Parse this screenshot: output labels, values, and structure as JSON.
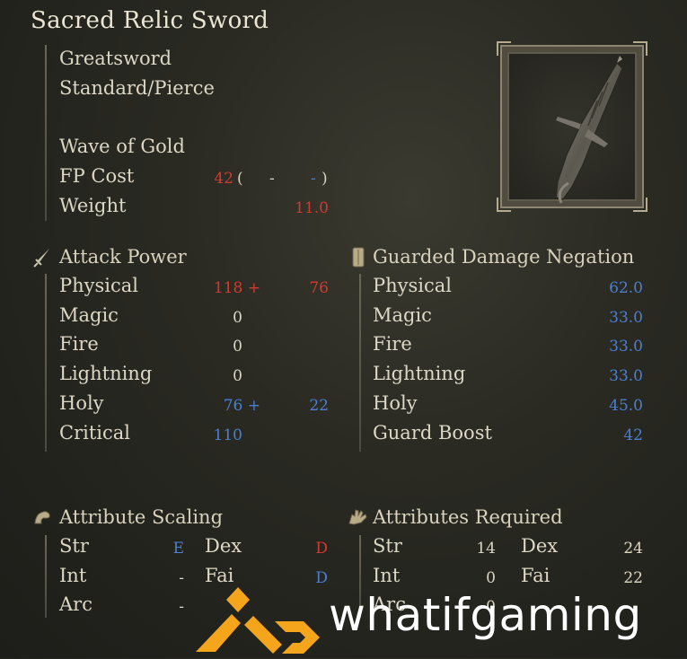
{
  "item": {
    "name": "Sacred Relic Sword",
    "type": "Greatsword",
    "attack_type": "Standard/Pierce",
    "skill": "Wave of Gold",
    "fp_label": "FP Cost",
    "fp_value": "42",
    "fp_paren_open": "(",
    "fp_dash1": "-",
    "fp_dash2": "-",
    "fp_paren_close": ")",
    "weight_label": "Weight",
    "weight_value": "11.0"
  },
  "attack_power": {
    "header": "Attack Power",
    "rows": [
      {
        "label": "Physical",
        "base": "118 +",
        "bonus": "76"
      },
      {
        "label": "Magic",
        "base": "0",
        "bonus": ""
      },
      {
        "label": "Fire",
        "base": "0",
        "bonus": ""
      },
      {
        "label": "Lightning",
        "base": "0",
        "bonus": ""
      },
      {
        "label": "Holy",
        "base": "76 +",
        "bonus": "22"
      },
      {
        "label": "Critical",
        "base": "110",
        "bonus": ""
      }
    ]
  },
  "guarded": {
    "header": "Guarded Damage Negation",
    "rows": [
      {
        "label": "Physical",
        "value": "62.0"
      },
      {
        "label": "Magic",
        "value": "33.0"
      },
      {
        "label": "Fire",
        "value": "33.0"
      },
      {
        "label": "Lightning",
        "value": "33.0"
      },
      {
        "label": "Holy",
        "value": "45.0"
      },
      {
        "label": "Guard Boost",
        "value": "42"
      }
    ]
  },
  "scaling": {
    "header": "Attribute Scaling",
    "rows": [
      {
        "a": "Str",
        "av": "E",
        "b": "Dex",
        "bv": "D"
      },
      {
        "a": "Int",
        "av": "-",
        "b": "Fai",
        "bv": "D"
      },
      {
        "a": "Arc",
        "av": "-",
        "b": "",
        "bv": ""
      }
    ]
  },
  "required": {
    "header": "Attributes Required",
    "rows": [
      {
        "a": "Str",
        "av": "14",
        "b": "Dex",
        "bv": "24"
      },
      {
        "a": "Int",
        "av": "0",
        "b": "Fai",
        "bv": "22"
      },
      {
        "a": "Arc",
        "av": "0",
        "b": "",
        "bv": ""
      }
    ]
  },
  "watermark": {
    "brand": "whatifgaming",
    "brand_color": "#f5a51c"
  },
  "icons": {
    "attack": "sword-icon",
    "guard": "shield-icon",
    "scaling": "arm-icon",
    "required": "hand-icon"
  }
}
